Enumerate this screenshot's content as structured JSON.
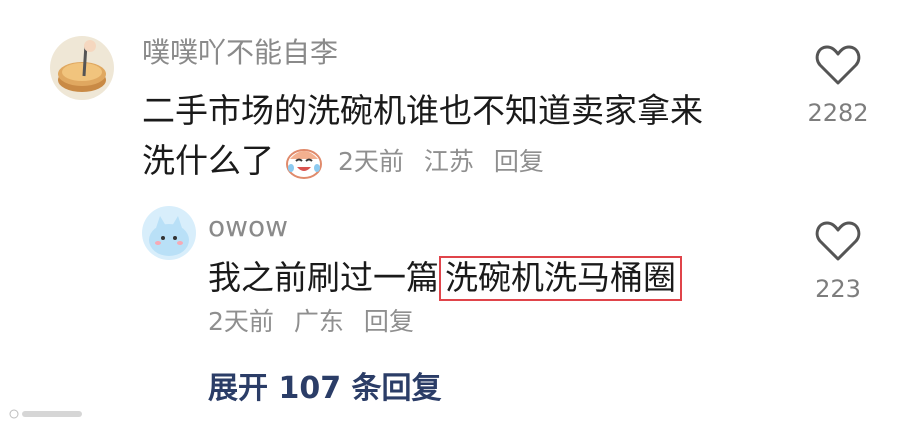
{
  "comments": [
    {
      "username": "噗噗吖不能自李",
      "text_line1": "二手市场的洗碗机谁也不知道卖家拿来",
      "text_line2_prefix": "洗什么了",
      "emoji": "crying-laughing-emoji",
      "time": "2天前",
      "location": "江苏",
      "reply_label": "回复",
      "likes": "2282"
    },
    {
      "username": "owow",
      "text_prefix": "我之前刷过一篇",
      "text_highlight": "洗碗机洗马桶圈",
      "time": "2天前",
      "location": "广东",
      "reply_label": "回复",
      "likes": "223"
    }
  ],
  "expand_replies": "展开 107 条回复",
  "colors": {
    "highlight_border": "#e0444a",
    "expand_link": "#2b3d67",
    "muted_text": "#8f8f8f"
  }
}
